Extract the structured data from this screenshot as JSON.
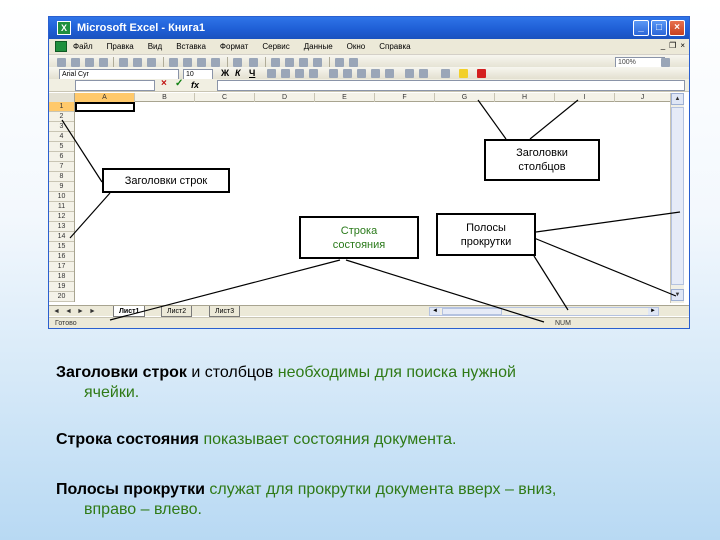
{
  "excel": {
    "title": "Microsoft Excel - Книга1",
    "app_icon": "excel-icon",
    "window_buttons": [
      "_",
      "□",
      "×"
    ],
    "menu": [
      "Файл",
      "Правка",
      "Вид",
      "Вставка",
      "Формат",
      "Сервис",
      "Данные",
      "Окно",
      "Справка"
    ],
    "font_name": "Arial Cyr",
    "font_size": "10",
    "format_buttons": [
      "Ж",
      "К",
      "Ч"
    ],
    "zoom": "100%",
    "formula_icons": [
      "×",
      "✓",
      "fx"
    ],
    "columns": [
      "A",
      "B",
      "C",
      "D",
      "E",
      "F",
      "G",
      "H",
      "I",
      "J"
    ],
    "rows": [
      "1",
      "2",
      "3",
      "4",
      "5",
      "6",
      "7",
      "8",
      "9",
      "10",
      "11",
      "12",
      "13",
      "14",
      "15",
      "16",
      "17",
      "18",
      "19",
      "20"
    ],
    "sheet_tabs": [
      "Лист1",
      "Лист2",
      "Лист3"
    ],
    "tab_nav": [
      "◄",
      "◄",
      "►",
      "►"
    ],
    "status_left": "Готово",
    "status_right": "NUM"
  },
  "callouts": {
    "row_headers": "Заголовки строк",
    "col_headers": "Заголовки столбцов",
    "status_bar": "Строка состояния",
    "scrollbars": "Полосы прокрутки"
  },
  "paragraphs": {
    "p1_bold": "Заголовки строк",
    "p1_plain": " и столбцов ",
    "p1_green_a": "необходимы для поиска нужной",
    "p1_green_b": "ячейки.",
    "p2_bold": "Строка состояния",
    "p2_green": " показывает состояния документа.",
    "p3_bold": "Полосы прокрутки",
    "p3_green_a": " служат для прокрутки документа вверх – вниз,",
    "p3_green_b": "вправо – влево."
  },
  "colors": {
    "titlebar": "#1f5fd6",
    "active_header": "#ffc96b",
    "green_text": "#2f7a16"
  }
}
